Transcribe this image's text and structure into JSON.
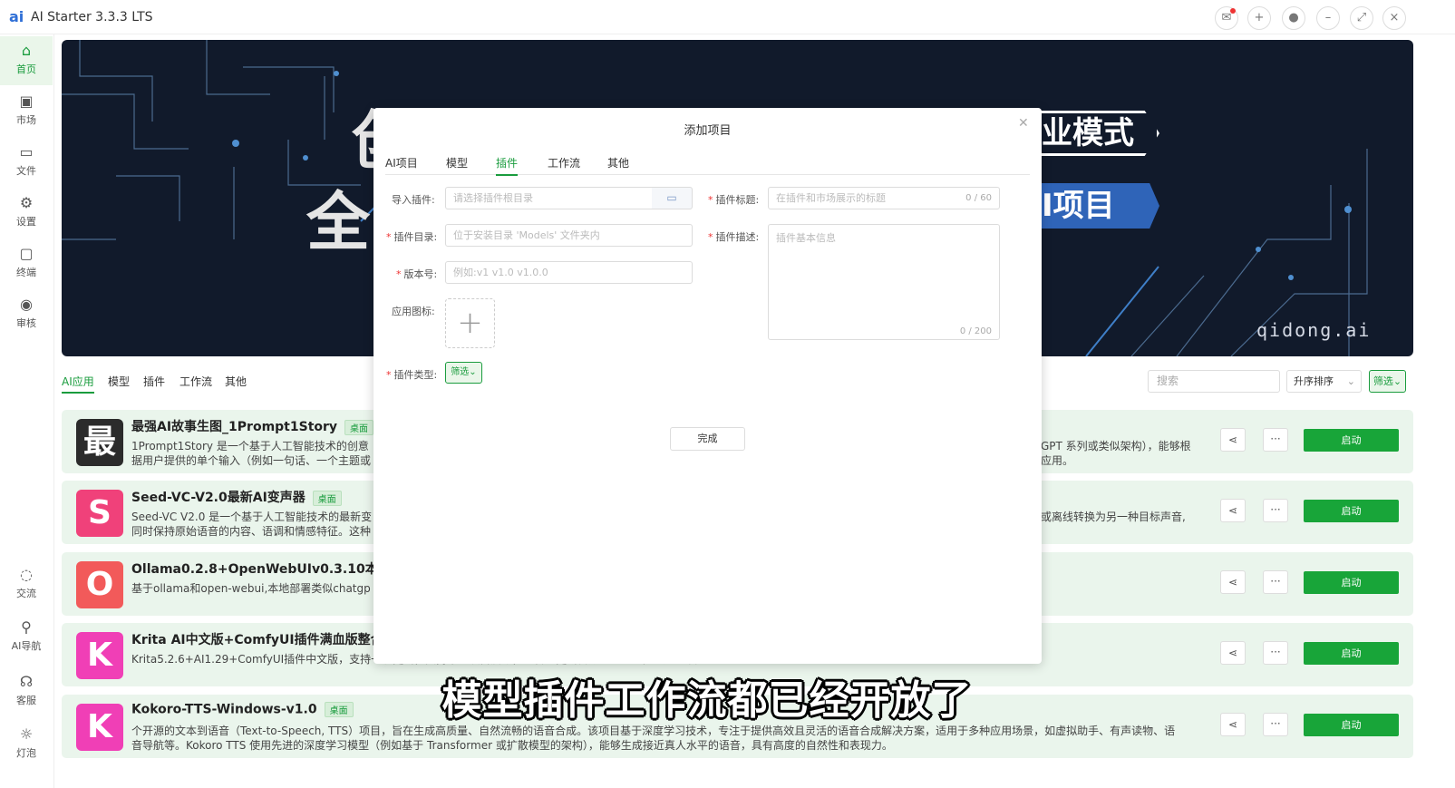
{
  "app": {
    "title": "AI Starter 3.3.3 LTS",
    "logo": "ai"
  },
  "titlebar_icons": [
    "mail-icon",
    "plus-icon",
    "user-icon",
    "minimize-icon",
    "maximize-icon",
    "close-icon"
  ],
  "sidebar": {
    "items": [
      {
        "label": "首页",
        "icon": "home-icon"
      },
      {
        "label": "市场",
        "icon": "store-icon"
      },
      {
        "label": "文件",
        "icon": "file-icon"
      },
      {
        "label": "设置",
        "icon": "gear-icon"
      },
      {
        "label": "终端",
        "icon": "terminal-icon"
      },
      {
        "label": "审核",
        "icon": "eye-icon"
      }
    ],
    "bottom_items": [
      {
        "label": "交流",
        "icon": "chat-icon"
      },
      {
        "label": "AI导航",
        "icon": "link-icon"
      },
      {
        "label": "客服",
        "icon": "headset-icon"
      },
      {
        "label": "灯泡",
        "icon": "sun-icon"
      }
    ]
  },
  "banner": {
    "text_left_top": "创",
    "text_left": "全",
    "mode_text": "业模式",
    "ai_text": "I项目",
    "url": "qidong.ai"
  },
  "categories": [
    "AI应用",
    "模型",
    "插件",
    "工作流",
    "其他"
  ],
  "search": {
    "placeholder": "搜索"
  },
  "sort": {
    "value": "升序排序"
  },
  "filter": {
    "label": "筛选"
  },
  "projects": [
    {
      "name": "最强AI故事生图_1Prompt1Story",
      "tag": "桌面",
      "icon_char": "最",
      "icon_color": "#2b2b2b",
      "desc": "1Prompt1Story 是一个基于人工智能技术的创意",
      "desc2": "据用户提供的单个输入（例如一句话、一个主题或",
      "desc_tail": "GPT 系列或类似架构），能够根",
      "desc_tail2": "应用。",
      "start": "启动"
    },
    {
      "name": "Seed-VC-V2.0最新AI变声器",
      "tag": "桌面",
      "icon_char": "S",
      "icon_color": "#f0417a",
      "desc": "Seed-VC V2.0 是一个基于人工智能技术的最新变",
      "desc2": "同时保持原始语音的内容、语调和情感特征。这种",
      "desc_tail": "或离线转换为另一种目标声音,",
      "desc_tail2": "",
      "start": "启动"
    },
    {
      "name": "Ollama0.2.8+OpenWebUIv0.3.10本地部署",
      "tag": "",
      "icon_char": "O",
      "icon_color": "#f25a5a",
      "desc": "基于ollama和open-webui,本地部署类似chatgp",
      "desc2": "",
      "desc_tail": "",
      "desc_tail2": "",
      "start": "启动"
    },
    {
      "name": "Krita AI中文版+ComfyUI插件满血版整合包",
      "tag": "",
      "icon_char": "K",
      "icon_color": "#f03fb6",
      "desc": "Krita5.2.6+AI1.29+ComfyUI插件中文版，支持一键更新，支持单个项目启动，整合包更新日期：2024年12月20日。",
      "desc2": "",
      "desc_tail": "",
      "desc_tail2": "",
      "start": "启动"
    },
    {
      "name": "Kokoro-TTS-Windows-v1.0",
      "tag": "桌面",
      "icon_char": "K",
      "icon_color": "#f03fb6",
      "desc": "个开源的文本到语音（Text-to-Speech, TTS）项目，旨在生成高质量、自然流畅的语音合成。该项目基于深度学习技术，专注于提供高效且灵活的语音合成解决方案，适用于多种应用场景，如虚拟助手、有声读物、语",
      "desc2": "音导航等。Kokoro TTS 使用先进的深度学习模型（例如基于 Transformer 或扩散模型的架构），能够生成接近真人水平的语音，具有高度的自然性和表现力。",
      "desc_tail": "",
      "desc_tail2": "",
      "start": "启动"
    }
  ],
  "modal": {
    "title": "添加项目",
    "tabs": [
      "AI项目",
      "模型",
      "插件",
      "工作流",
      "其他"
    ],
    "active_tab": "插件",
    "fields": {
      "import_label": "导入插件:",
      "import_placeholder": "请选择插件根目录",
      "dir_label": "插件目录:",
      "dir_placeholder": "位于安装目录 'Models' 文件夹内",
      "version_label": "版本号:",
      "version_placeholder": "例如:v1 v1.0 v1.0.0",
      "icon_label": "应用图标:",
      "type_label": "插件类型:",
      "type_value": "筛选",
      "title_label": "插件标题:",
      "title_placeholder": "在插件和市场展示的标题",
      "title_count": "0 / 60",
      "desc_label": "插件描述:",
      "desc_placeholder": "插件基本信息",
      "desc_count": "0 / 200"
    },
    "done": "完成"
  },
  "caption": "模型插件工作流都已经开放了",
  "colors": {
    "accent": "#1a9c3e",
    "start_button": "#18a539",
    "card_bg": "#eaf5ec"
  }
}
